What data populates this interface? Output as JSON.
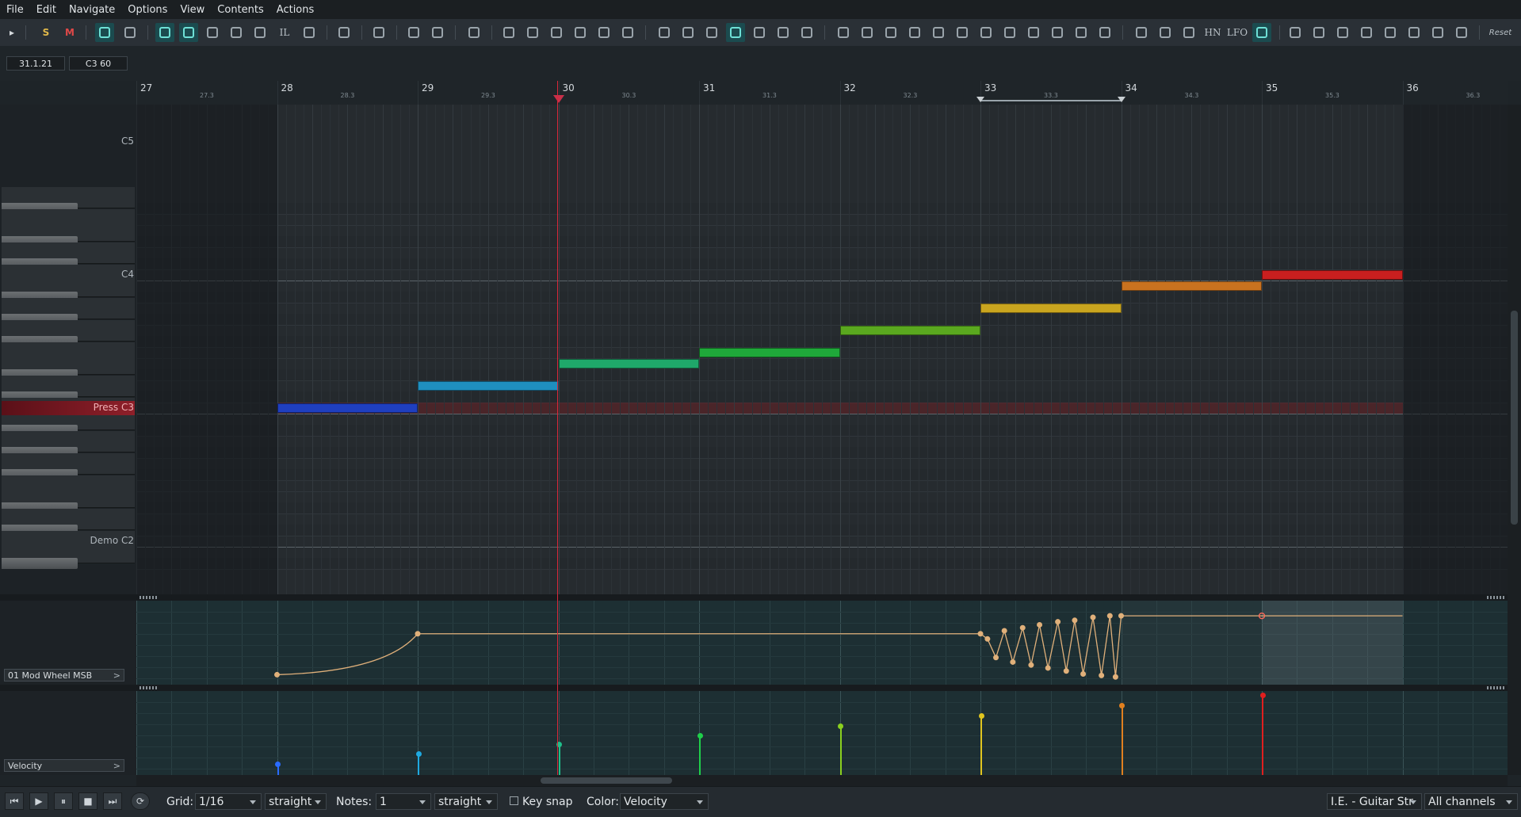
{
  "menu": [
    "File",
    "Edit",
    "Navigate",
    "Options",
    "View",
    "Contents",
    "Actions"
  ],
  "toolbar": {
    "solo_label": "S",
    "mute_label": "M",
    "il_label": "IL",
    "hn_label": "HN",
    "lfo_label": "LFO",
    "reset_label": "Reset"
  },
  "info": {
    "position": "31.1.21",
    "pitch": "C3  60"
  },
  "ruler": {
    "bars": [
      "27",
      "28",
      "29",
      "30",
      "31",
      "32",
      "33",
      "34",
      "35",
      "36"
    ],
    "subs": [
      "27.3",
      "28.3",
      "29.3",
      "30.3",
      "31.3",
      "32.3",
      "33.3",
      "34.3",
      "35.3",
      "36.3"
    ]
  },
  "keyboard": {
    "c5": "C5",
    "c4": "C4",
    "c3": "Press C3",
    "c2": "Demo C2"
  },
  "notes": [
    {
      "bar": 28,
      "length_beats": 4,
      "pitch": "C3",
      "color": "#1f3fbf"
    },
    {
      "bar": 29,
      "length_beats": 4,
      "pitch": "D3",
      "color": "#1f8fbf"
    },
    {
      "bar": 30,
      "length_beats": 4,
      "pitch": "E3",
      "color": "#1fa86a"
    },
    {
      "bar": 31,
      "length_beats": 4,
      "pitch": "F3",
      "color": "#1fa83a"
    },
    {
      "bar": 32,
      "length_beats": 4,
      "pitch": "G3",
      "color": "#5aa81f"
    },
    {
      "bar": 33,
      "length_beats": 4,
      "pitch": "A3",
      "color": "#c9a51f"
    },
    {
      "bar": 34,
      "length_beats": 4,
      "pitch": "B3",
      "color": "#c9721f"
    },
    {
      "bar": 35,
      "length_beats": 4,
      "pitch": "C4",
      "color": "#c91f1f"
    }
  ],
  "cc_lane": {
    "label": "01 Mod Wheel MSB",
    "points": [
      [
        28,
        0.07
      ],
      [
        29,
        0.62
      ],
      [
        33,
        0.62
      ],
      [
        33.05,
        0.55
      ],
      [
        33.11,
        0.3
      ],
      [
        33.17,
        0.66
      ],
      [
        33.23,
        0.24
      ],
      [
        33.3,
        0.7
      ],
      [
        33.36,
        0.2
      ],
      [
        33.42,
        0.74
      ],
      [
        33.48,
        0.16
      ],
      [
        33.55,
        0.78
      ],
      [
        33.61,
        0.12
      ],
      [
        33.67,
        0.8
      ],
      [
        33.73,
        0.08
      ],
      [
        33.8,
        0.84
      ],
      [
        33.86,
        0.06
      ],
      [
        33.92,
        0.86
      ],
      [
        33.96,
        0.04
      ],
      [
        34,
        0.86
      ],
      [
        35,
        0.86
      ],
      [
        36,
        0.86
      ]
    ]
  },
  "velocity_lane": {
    "label": "Velocity",
    "bars": [
      {
        "bar": 28,
        "value": 0.05,
        "color": "#2a6bff"
      },
      {
        "bar": 29,
        "value": 0.2,
        "color": "#1fa9e0"
      },
      {
        "bar": 30,
        "value": 0.33,
        "color": "#1fbf8a"
      },
      {
        "bar": 31,
        "value": 0.45,
        "color": "#1fcf4a"
      },
      {
        "bar": 32,
        "value": 0.58,
        "color": "#8ad01f"
      },
      {
        "bar": 33,
        "value": 0.72,
        "color": "#e0c51f"
      },
      {
        "bar": 34,
        "value": 0.86,
        "color": "#e0801f"
      },
      {
        "bar": 35,
        "value": 1.0,
        "color": "#e01f1f"
      }
    ]
  },
  "bottom": {
    "grid_label": "Grid:",
    "grid_value": "1/16",
    "grid_mode": "straight",
    "notes_label": "Notes:",
    "notes_value": "1",
    "notes_mode": "straight",
    "keysnap_label": "Key snap",
    "color_label": "Color:",
    "color_value": "Velocity",
    "instrument": "I.E. - Guitar Str",
    "channels": "All channels"
  }
}
